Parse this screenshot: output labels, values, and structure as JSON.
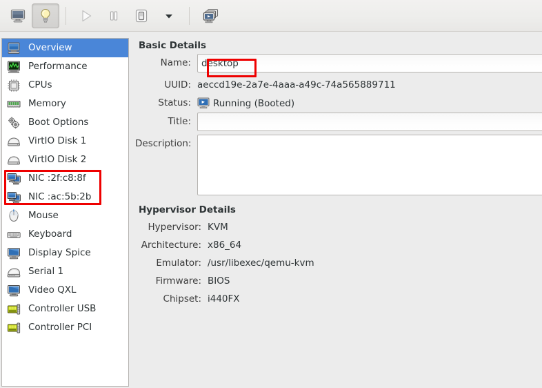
{
  "window": {
    "app": "virt-manager-vm-details",
    "accent_selection": "#4a86d8",
    "background": "#ececec",
    "annotation_color": "#ee0000"
  },
  "toolbar": {
    "buttons": [
      {
        "name": "show-console-button",
        "icon": "monitor-icon",
        "label": "Console",
        "state": "normal"
      },
      {
        "name": "show-details-button",
        "icon": "lightbulb-icon",
        "label": "Details",
        "state": "pressed"
      },
      {
        "name": "run-button",
        "icon": "play-icon",
        "label": "Run",
        "state": "disabled"
      },
      {
        "name": "pause-button",
        "icon": "pause-icon",
        "label": "Pause",
        "state": "normal"
      },
      {
        "name": "shutdown-button",
        "icon": "power-icon",
        "label": "Shut Down",
        "state": "normal"
      },
      {
        "name": "shutdown-menu-button",
        "icon": "chevron-down-icon",
        "label": "Shut Down Options",
        "state": "normal"
      },
      {
        "name": "snapshots-button",
        "icon": "snapshots-icon",
        "label": "Snapshots",
        "state": "normal"
      }
    ]
  },
  "sidebar": {
    "items": [
      {
        "label": "Overview",
        "icon": "computer-icon",
        "selected": true
      },
      {
        "label": "Performance",
        "icon": "graph-icon",
        "selected": false
      },
      {
        "label": "CPUs",
        "icon": "cpu-icon",
        "selected": false
      },
      {
        "label": "Memory",
        "icon": "memory-icon",
        "selected": false
      },
      {
        "label": "Boot Options",
        "icon": "gears-icon",
        "selected": false
      },
      {
        "label": "VirtIO Disk 1",
        "icon": "harddisk-icon",
        "selected": false
      },
      {
        "label": "VirtIO Disk 2",
        "icon": "harddisk-icon",
        "selected": false
      },
      {
        "label": "NIC :2f:c8:8f",
        "icon": "network-icon",
        "selected": false
      },
      {
        "label": "NIC :ac:5b:2b",
        "icon": "network-icon",
        "selected": false
      },
      {
        "label": "Mouse",
        "icon": "mouse-icon",
        "selected": false
      },
      {
        "label": "Keyboard",
        "icon": "keyboard-icon",
        "selected": false
      },
      {
        "label": "Display Spice",
        "icon": "display-icon",
        "selected": false
      },
      {
        "label": "Serial 1",
        "icon": "serial-icon",
        "selected": false
      },
      {
        "label": "Video QXL",
        "icon": "display-icon",
        "selected": false
      },
      {
        "label": "Controller USB",
        "icon": "controller-icon",
        "selected": false
      },
      {
        "label": "Controller PCI",
        "icon": "controller-icon",
        "selected": false
      }
    ]
  },
  "basic_details": {
    "title": "Basic Details",
    "name_label": "Name:",
    "name_value": "desktop",
    "name_placeholder": "",
    "uuid_label": "UUID:",
    "uuid_value": "aeccd19e-2a7e-4aaa-a49c-74a565889711",
    "status_label": "Status:",
    "status_value": "Running (Booted)",
    "status_icon": "running-monitor-icon",
    "title_label": "Title:",
    "title_value": "",
    "title_placeholder": "",
    "description_label": "Description:",
    "description_value": "",
    "description_placeholder": ""
  },
  "hypervisor_details": {
    "title": "Hypervisor Details",
    "rows": [
      {
        "label": "Hypervisor:",
        "value": "KVM"
      },
      {
        "label": "Architecture:",
        "value": "x86_64"
      },
      {
        "label": "Emulator:",
        "value": "/usr/libexec/qemu-kvm"
      },
      {
        "label": "Firmware:",
        "value": "BIOS"
      },
      {
        "label": "Chipset:",
        "value": "i440FX"
      }
    ]
  },
  "annotations": [
    {
      "name": "name-field-highlight",
      "target": "name_value"
    },
    {
      "name": "nic-items-highlight",
      "target": "sidebar NIC items"
    }
  ]
}
